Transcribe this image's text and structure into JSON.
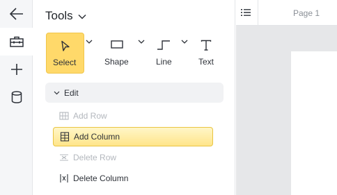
{
  "rail": {
    "items": [
      {
        "icon": "back-arrow-icon"
      },
      {
        "icon": "toolbox-icon",
        "active": true
      },
      {
        "icon": "plus-icon"
      },
      {
        "icon": "database-icon"
      }
    ]
  },
  "panel": {
    "title": "Tools",
    "tools": [
      {
        "label": "Select",
        "icon": "cursor-icon",
        "selected": true
      },
      {
        "label": "Shape",
        "icon": "rectangle-icon"
      },
      {
        "label": "Line",
        "icon": "elbow-line-icon"
      },
      {
        "label": "Text",
        "icon": "text-icon"
      }
    ],
    "edit": {
      "label": "Edit",
      "items": [
        {
          "label": "Add Row",
          "icon": "add-row-icon",
          "disabled": true
        },
        {
          "label": "Add Column",
          "icon": "add-column-icon",
          "highlighted": true
        },
        {
          "label": "Delete Row",
          "icon": "delete-row-icon",
          "disabled": true
        },
        {
          "label": "Delete Column",
          "icon": "delete-column-icon",
          "disabled": false
        }
      ]
    }
  },
  "canvas": {
    "page_label": "Page 1"
  },
  "colors": {
    "accent": "#ffd96a",
    "highlight_border": "#e9c441",
    "rail_bg": "#f5f6f8",
    "canvas_bg": "#e6e7e9"
  }
}
